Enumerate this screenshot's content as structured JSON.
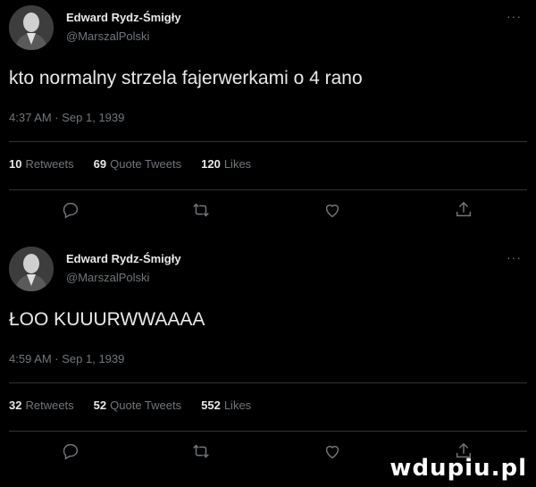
{
  "tweets": [
    {
      "author_name": "Edward Rydz-Śmigły",
      "author_handle": "@MarszalPolski",
      "more": "···",
      "text": "kto normalny strzela fajerwerkami o 4 rano",
      "timestamp": "4:37 AM · Sep 1, 1939",
      "retweets_count": "10",
      "retweets_label": "Retweets",
      "quotes_count": "69",
      "quotes_label": "Quote Tweets",
      "likes_count": "120",
      "likes_label": "Likes"
    },
    {
      "author_name": "Edward Rydz-Śmigły",
      "author_handle": "@MarszalPolski",
      "more": "···",
      "text": "ŁOO KUUURWWAAAA",
      "timestamp": "4:59 AM · Sep 1, 1939",
      "retweets_count": "32",
      "retweets_label": "Retweets",
      "quotes_count": "52",
      "quotes_label": "Quote Tweets",
      "likes_count": "552",
      "likes_label": "Likes"
    }
  ],
  "icons": [
    "reply-icon",
    "retweet-icon",
    "like-icon",
    "share-icon"
  ],
  "watermark": "wdupiu.pl",
  "colors": {
    "background": "#000000",
    "text": "#e7e9ea",
    "muted": "#71767b",
    "divider": "#2f3336"
  }
}
